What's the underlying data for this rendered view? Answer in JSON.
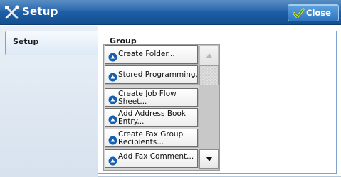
{
  "window": {
    "title": "Setup",
    "title_icon": "tools-icon"
  },
  "header": {
    "close_label": "Close",
    "close_icon": "checkmark-icon"
  },
  "sidebar": {
    "tabs": [
      {
        "label": "Setup",
        "selected": true
      }
    ]
  },
  "group": {
    "label": "Group",
    "items": [
      {
        "label": "Create Folder...",
        "icon": "blue-circle-arrow-icon"
      },
      {
        "label": "Stored Programming...",
        "icon": "blue-circle-arrow-icon"
      },
      {
        "label_line1": "Create Job Flow",
        "label_line2": "Sheet...",
        "icon": "blue-circle-arrow-icon"
      },
      {
        "label_line1": "Add Address Book",
        "label_line2": "Entry...",
        "icon": "blue-circle-arrow-icon"
      },
      {
        "label_line1": "Create Fax Group",
        "label_line2": "Recipients...",
        "icon": "blue-circle-arrow-icon"
      },
      {
        "label": "Add Fax Comment...",
        "icon": "blue-circle-arrow-icon"
      }
    ]
  },
  "scroll": {
    "up_icon": "triangle-up-icon",
    "down_icon": "triangle-down-icon",
    "up_enabled": false,
    "down_enabled": true
  },
  "colors": {
    "titlebar": "#1d5ea8",
    "close_button": "#3f86cf",
    "item_icon": "#1560b0",
    "panel_border": "#7fa3c8"
  }
}
